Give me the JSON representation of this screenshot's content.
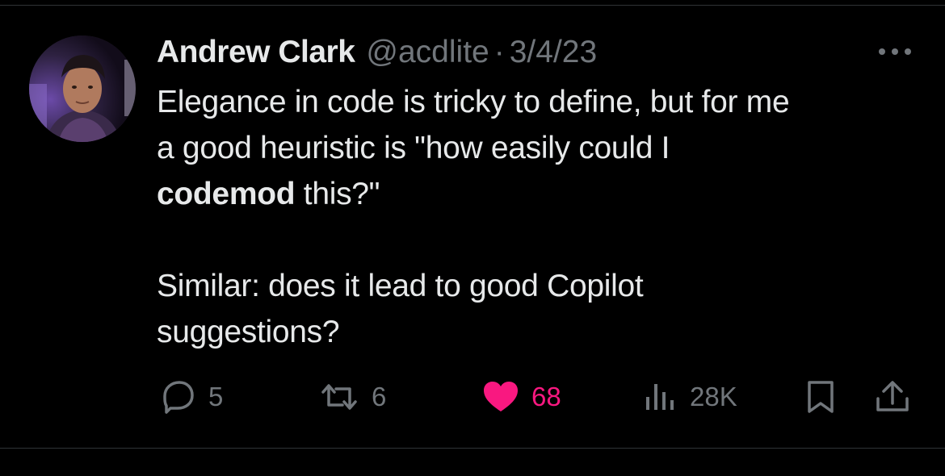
{
  "author": {
    "display_name": "Andrew Clark",
    "handle": "@acdlite",
    "separator": "·",
    "date": "3/4/23",
    "avatar_icon": "profile-photo"
  },
  "more_icon": "ellipsis-icon",
  "body": {
    "line1": "Elegance in code is tricky to define, but for me",
    "line2": "a good heuristic is \"how easily could I",
    "line3_bold": "codemod",
    "line3_rest": " this?\"",
    "line4": "Similar: does it lead to good Copilot",
    "line5": "suggestions?"
  },
  "actions": {
    "replies": {
      "icon": "reply-icon",
      "count": "5"
    },
    "retweets": {
      "icon": "retweet-icon",
      "count": "6"
    },
    "likes": {
      "icon": "heart-icon",
      "count": "68",
      "liked": true,
      "color": "#f91880"
    },
    "views": {
      "icon": "views-icon",
      "count": "28K"
    },
    "bookmark": {
      "icon": "bookmark-icon"
    },
    "share": {
      "icon": "share-icon"
    }
  },
  "colors": {
    "background": "#000000",
    "text": "#e7e9ea",
    "secondary": "#71767b",
    "like": "#f91880"
  }
}
